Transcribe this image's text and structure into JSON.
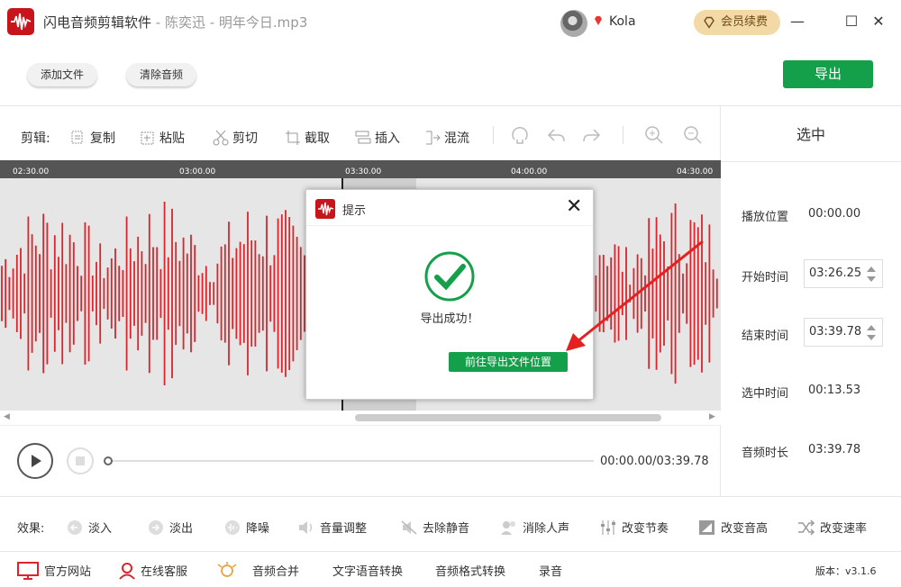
{
  "app": {
    "name": "闪电音频剪辑软件",
    "sep": " - ",
    "file": "陈奕迅 - 明年今日.mp3"
  },
  "user": {
    "name": "Kola",
    "vip_label": "会员续费"
  },
  "window": {
    "min": "—",
    "max": "☐",
    "close": "✕"
  },
  "toolbar": {
    "add_file": "添加文件",
    "clear_audio": "清除音频",
    "export": "导出"
  },
  "edit": {
    "label": "剪辑:",
    "tools": [
      "复制",
      "粘贴",
      "剪切",
      "截取",
      "插入",
      "混流"
    ]
  },
  "ruler": {
    "ticks": [
      "02:30.00",
      "03:00.00",
      "03:30.00",
      "04:00.00",
      "04:30.00"
    ]
  },
  "right_panel": {
    "title": "选中",
    "play_pos_label": "播放位置",
    "play_pos": "00:00.00",
    "start_label": "开始时间",
    "start": "03:26.25",
    "end_label": "结束时间",
    "end": "03:39.78",
    "sel_label": "选中时间",
    "sel": "00:13.53",
    "dur_label": "音频时长",
    "dur": "03:39.78"
  },
  "player": {
    "time": "00:00.00/03:39.78"
  },
  "effects": {
    "label": "效果:",
    "items": [
      "淡入",
      "淡出",
      "降噪",
      "音量调整",
      "去除静音",
      "消除人声",
      "改变节奏",
      "改变音高",
      "改变速率"
    ]
  },
  "footer": {
    "items": [
      "官方网站",
      "在线客服",
      "音频合并",
      "文字语音转换",
      "音频格式转换",
      "录音"
    ],
    "version": "版本：v3.1.6"
  },
  "dialog": {
    "title": "提示",
    "message": "导出成功！",
    "button": "前往导出文件位置",
    "close": "✕"
  },
  "colors": {
    "brand": "#c8151b",
    "accent": "#14a04a",
    "vip": "#f3d9a6",
    "wave": "#d9252b"
  }
}
